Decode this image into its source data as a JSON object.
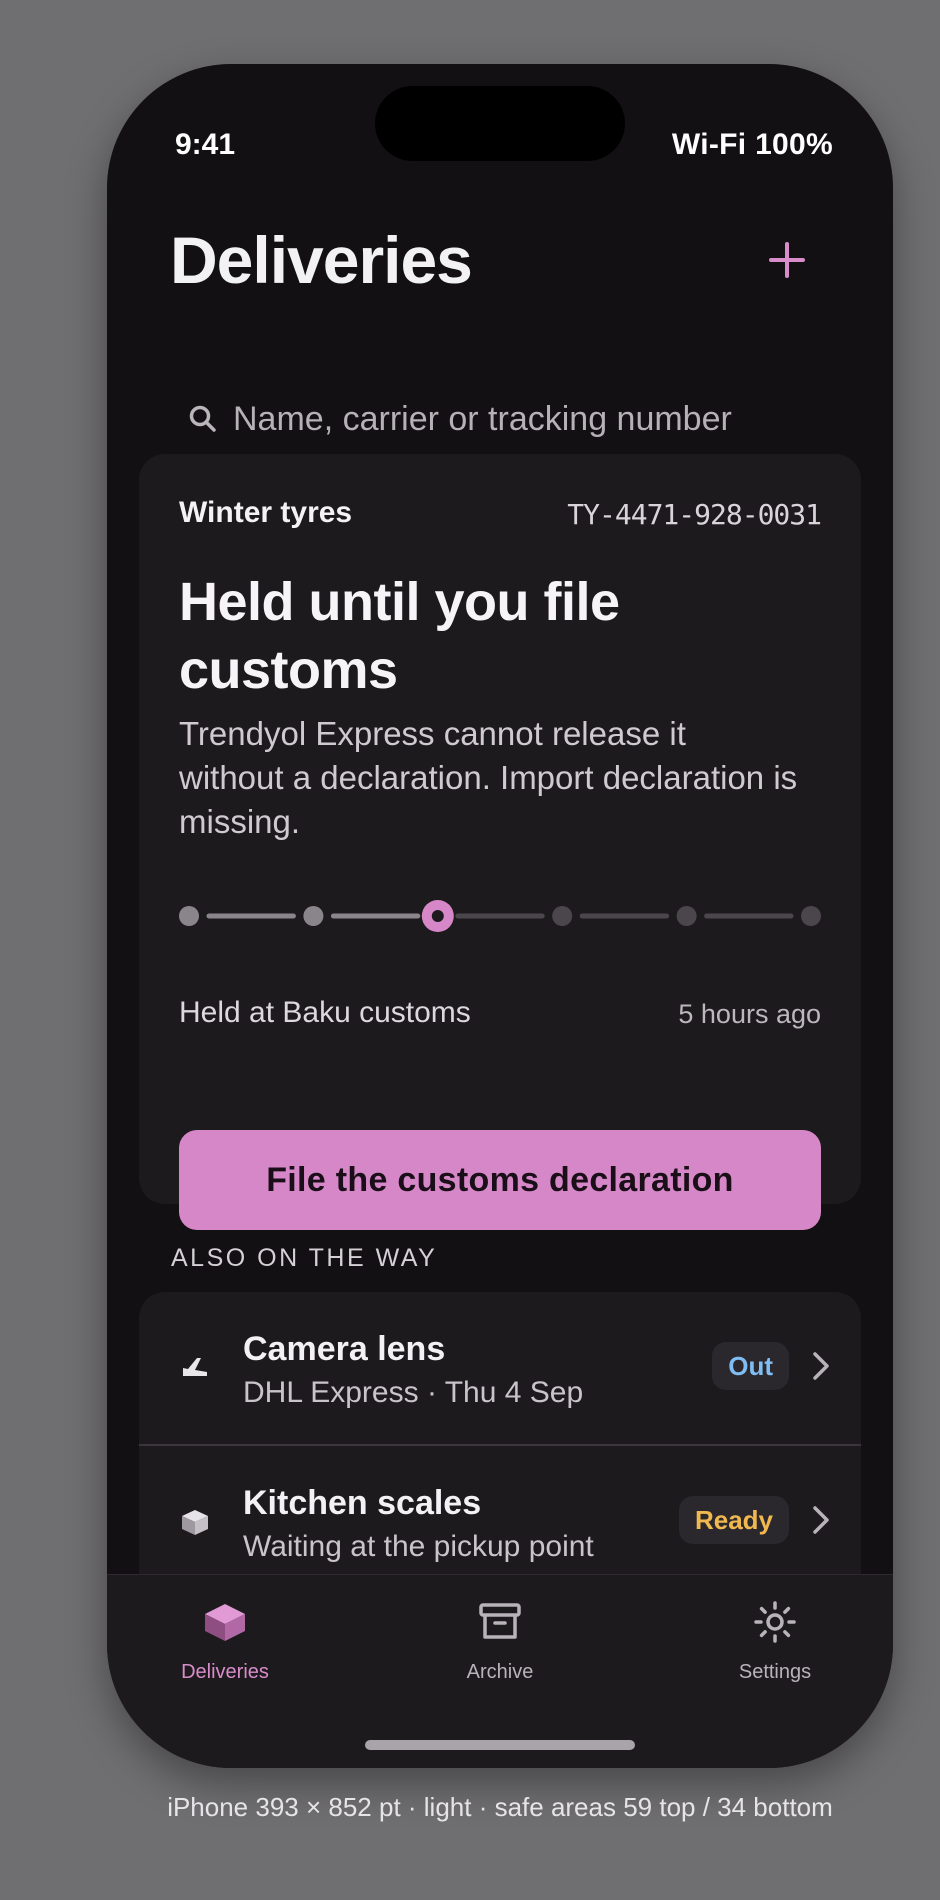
{
  "status_bar": {
    "time": "9:41",
    "right": "Wi-Fi  100%"
  },
  "header": {
    "title": "Deliveries"
  },
  "search": {
    "placeholder": "Name, carrier or tracking number"
  },
  "hero": {
    "name": "Winter tyres",
    "tracking": "TY-4471-928-0031",
    "headline": "Held until you file customs",
    "description": "Trendyol Express cannot release it without a declaration. Import declaration is missing.",
    "progress": {
      "steps_total": 6,
      "current_step": 3
    },
    "location": "Held at Baku customs",
    "time": "5 hours ago",
    "cta_label": "File the customs declaration"
  },
  "section": {
    "label": "ALSO ON THE WAY"
  },
  "list": [
    {
      "title": "Camera lens",
      "subtitle": "DHL Express · Thu 4 Sep",
      "badge": "Out",
      "icon": "plane-icon"
    },
    {
      "title": "Kitchen scales",
      "subtitle": "Waiting at the pickup point",
      "badge": "Ready",
      "icon": "package-icon"
    }
  ],
  "tabs": [
    {
      "label": "Deliveries",
      "icon": "package-icon",
      "active": true
    },
    {
      "label": "Archive",
      "icon": "archive-icon",
      "active": false
    },
    {
      "label": "Settings",
      "icon": "gear-icon",
      "active": false
    }
  ],
  "caption": "iPhone 393 × 852 pt · light · safe areas 59 top / 34 bottom",
  "colors": {
    "accent": "#d687c7",
    "badge_out": "#7fbdf2",
    "badge_ready": "#f1b84f",
    "background": "#121012",
    "card": "#1d1a1e"
  }
}
